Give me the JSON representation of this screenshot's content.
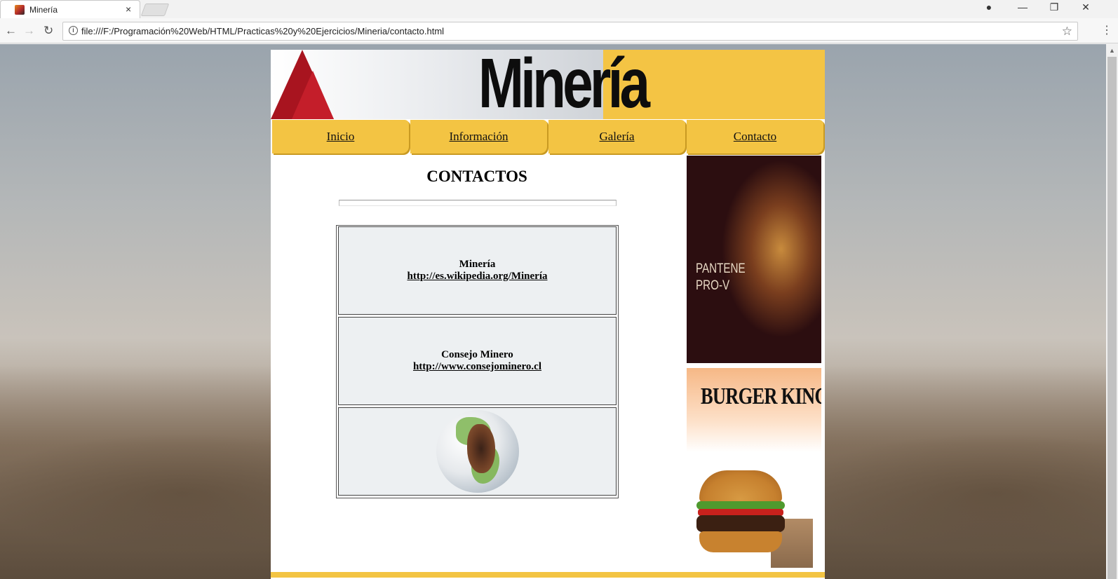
{
  "browser": {
    "tab_title": "Minería",
    "tab_close": "×",
    "url": "file:///F:/Programación%20Web/HTML/Practicas%20y%20Ejercicios/Mineria/contacto.html",
    "back_icon": "←",
    "forward_icon": "→",
    "reload_icon": "↻",
    "info_icon": "i",
    "star_icon": "☆",
    "menu_icon": "⋮",
    "profile_icon": "●",
    "minimize_icon": "—",
    "restore_icon": "❐",
    "close_icon": "✕"
  },
  "banner": {
    "title": "Minería"
  },
  "nav": {
    "items": [
      {
        "label": "Inicio"
      },
      {
        "label": "Información"
      },
      {
        "label": "Galería"
      },
      {
        "label": "Contacto"
      }
    ]
  },
  "main": {
    "heading": "CONTACTOS",
    "contacts": [
      {
        "name": "Minería",
        "link": "http://es.wikipedia.org/Minería"
      },
      {
        "name": "Consejo Minero",
        "link": "http://www.consejominero.cl"
      }
    ]
  },
  "ads": {
    "pantene_line1": "PANTENE",
    "pantene_line2": "PRO-V",
    "burger_king": "BURGER KING"
  },
  "colors": {
    "accent_yellow": "#f3c443",
    "banner_red": "#a8141f"
  }
}
